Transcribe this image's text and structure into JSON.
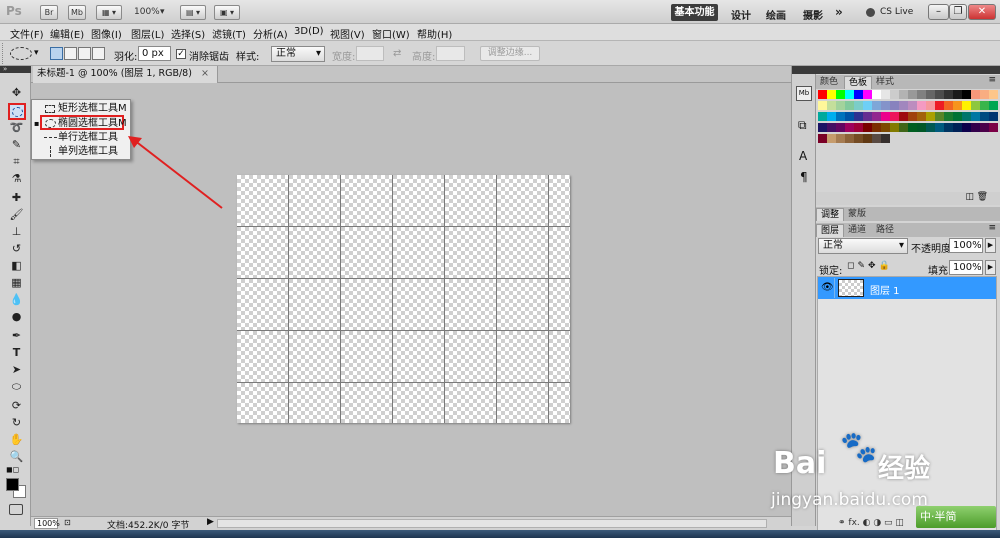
{
  "app": {
    "logo": "Ps",
    "bar_buttons": [
      "Br",
      "Mb"
    ],
    "zoom": "100%",
    "workspaces": {
      "active": "基本功能",
      "others": [
        "设计",
        "绘画",
        "摄影"
      ],
      "more": "»"
    },
    "cs_live": "CS Live",
    "window_controls": [
      "–",
      "❐",
      "✕"
    ]
  },
  "menubar": [
    "文件(F)",
    "编辑(E)",
    "图像(I)",
    "图层(L)",
    "选择(S)",
    "滤镜(T)",
    "分析(A)",
    "3D(D)",
    "视图(V)",
    "窗口(W)",
    "帮助(H)"
  ],
  "options": {
    "feather_label": "羽化:",
    "feather_value": "0 px",
    "antialias_label": "消除锯齿",
    "style_label": "样式:",
    "style_value": "正常",
    "width_label": "宽度:",
    "height_label": "高度:",
    "refine_edge": "调整边缘..."
  },
  "document": {
    "tab_title": "未标题-1 @ 100% (图层 1, RGB/8)",
    "status_zoom": "100%",
    "status_doc": "文档:452.2K/0 字节"
  },
  "flyout": {
    "items": [
      {
        "label": "矩形选框工具",
        "key": "M",
        "selected": false
      },
      {
        "label": "椭圆选框工具",
        "key": "M",
        "selected": true
      },
      {
        "label": "单行选框工具",
        "key": "",
        "selected": false
      },
      {
        "label": "单列选框工具",
        "key": "",
        "selected": false
      }
    ]
  },
  "panels": {
    "swatch_tabs": [
      "颜色",
      "色板",
      "样式"
    ],
    "adjust_tabs": [
      "调整",
      "蒙版"
    ],
    "layer_tabs": [
      "图层",
      "通道",
      "路径"
    ],
    "blend_mode": "正常",
    "opacity_label": "不透明度:",
    "opacity_value": "100%",
    "lock_label": "锁定:",
    "fill_label": "填充:",
    "fill_value": "100%",
    "layer_name": "图层 1"
  },
  "watermark": {
    "brand": "Bai",
    "brand2": "经验",
    "url": "jingyan.baidu.com",
    "ime": "中·半简"
  },
  "colors": {
    "highlight_red": "#e02020",
    "layer_selected": "#3399ff"
  }
}
